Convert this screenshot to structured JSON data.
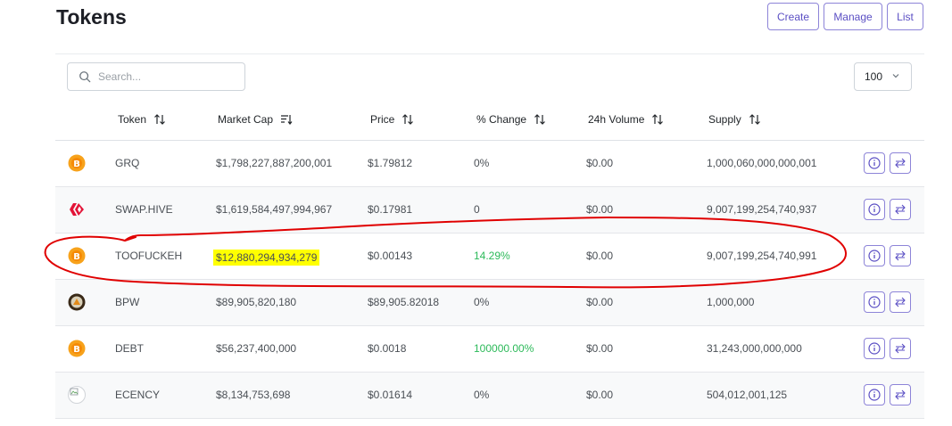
{
  "header": {
    "title": "Tokens",
    "buttons": {
      "create": "Create",
      "manage": "Manage",
      "list": "List"
    }
  },
  "toolbar": {
    "search_placeholder": "Search...",
    "page_size": "100"
  },
  "table": {
    "columns": {
      "token": "Token",
      "market_cap": "Market Cap",
      "price": "Price",
      "change": "% Change",
      "volume": "24h Volume",
      "supply": "Supply"
    },
    "rows": [
      {
        "symbol": "GRQ",
        "market_cap": "$1,798,227,887,200,001",
        "price": "$1.79812",
        "change": "0%",
        "volume": "$0.00",
        "supply": "1,000,060,000,000,001",
        "logo": "orange-coin-icon"
      },
      {
        "symbol": "SWAP.HIVE",
        "market_cap": "$1,619,584,497,994,967",
        "price": "$0.17981",
        "change": "0",
        "volume": "$0.00",
        "supply": "9,007,199,254,740,937",
        "logo": "hive-icon"
      },
      {
        "symbol": "TOOFUCKEH",
        "market_cap": "$12,880,294,934,279",
        "price": "$0.00143",
        "change": "14.29%",
        "volume": "$0.00",
        "supply": "9,007,199,254,740,991",
        "logo": "orange-coin-icon"
      },
      {
        "symbol": "BPW",
        "market_cap": "$89,905,820,180",
        "price": "$89,905.82018",
        "change": "0%",
        "volume": "$0.00",
        "supply": "1,000,000",
        "logo": "bpw-logo-icon"
      },
      {
        "symbol": "DEBT",
        "market_cap": "$56,237,400,000",
        "price": "$0.0018",
        "change": "100000.00%",
        "volume": "$0.00",
        "supply": "31,243,000,000,000",
        "logo": "orange-coin-icon"
      },
      {
        "symbol": "ECENCY",
        "market_cap": "$8,134,753,698",
        "price": "$0.01614",
        "change": "0%",
        "volume": "$0.00",
        "supply": "504,012,001,125",
        "logo": "broken-image-icon"
      }
    ]
  },
  "colors": {
    "accent": "#5b4fc4",
    "positive": "#2dba5a",
    "highlight": "#ffff00",
    "annotation": "#e00000"
  }
}
